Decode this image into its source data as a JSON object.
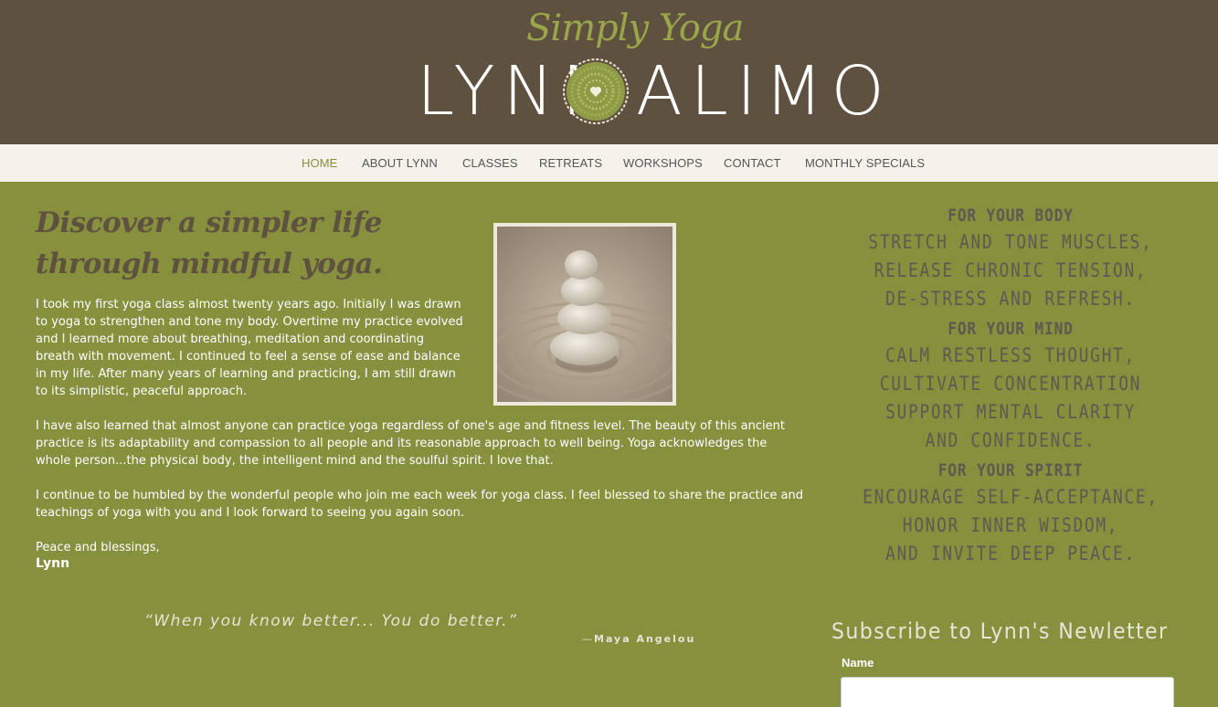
{
  "header": {
    "logo_script": "Simply Yoga",
    "logo_name_left": "LYNN",
    "logo_name_right": "ALIMO"
  },
  "nav": {
    "items": [
      {
        "label": "HOME"
      },
      {
        "label": "ABOUT LYNN"
      },
      {
        "label": "CLASSES"
      },
      {
        "label": "RETREATS"
      },
      {
        "label": "WORKSHOPS"
      },
      {
        "label": "CONTACT"
      },
      {
        "label": "MONTHLY SPECIALS"
      }
    ],
    "active": "HOME"
  },
  "main": {
    "headline": "Discover a simpler life through mindful yoga.",
    "paragraphs": [
      "I took my first yoga class almost twenty years ago.  Initially I was drawn to yoga to strengthen and tone my body.  Overtime my practice evolved and I learned more about breathing, meditation and coordinating breath with movement.  I continued to feel a sense of ease and balance in my life.   After many years of learning and practicing, I am still drawn to its simplistic, peaceful approach.",
      "I have also learned that almost anyone can practice yoga regardless of one's age and fitness level.  The beauty of this ancient practice is its adaptability and compassion to all people and its reasonable approach to well being.  Yoga acknowledges the whole person...the physical body, the intelligent mind and the soulful spirit.  I love that.",
      "I continue to be humbled by the wonderful people who join me each week for yoga class.  I feel blessed to share the practice and teachings of yoga with you and I look forward to seeing you again soon.",
      "Peace and blessings,"
    ],
    "signoff": "Lynn",
    "quote": "“When you know better... You do better.”",
    "quote_author_dash": "—",
    "quote_author": "Maya Angelou"
  },
  "sidebar": {
    "sections": [
      {
        "heading": "FOR YOUR BODY",
        "lines": [
          "STRETCH AND TONE MUSCLES,",
          "RELEASE CHRONIC TENSION,",
          "DE-STRESS AND REFRESH."
        ]
      },
      {
        "heading": "FOR YOUR MIND",
        "lines": [
          "CALM RESTLESS THOUGHT,",
          "CULTIVATE CONCENTRATION",
          "SUPPORT MENTAL CLARITY",
          "AND CONFIDENCE."
        ]
      },
      {
        "heading": "FOR YOUR SPIRIT",
        "lines": [
          "ENCOURAGE SELF-ACCEPTANCE,",
          "HONOR INNER WISDOM,",
          "AND INVITE DEEP PEACE."
        ]
      }
    ],
    "subscribe_title": "Subscribe to Lynn's Newletter",
    "name_label": "Name",
    "name_value": ""
  },
  "colors": {
    "header_bg": "#5f5140",
    "nav_bg": "#f4f2ea",
    "page_bg": "#86903d",
    "accent": "#86903d"
  },
  "icons": {
    "logo_emblem": "heart-mandala-icon",
    "photo": "zen-stones-image"
  }
}
